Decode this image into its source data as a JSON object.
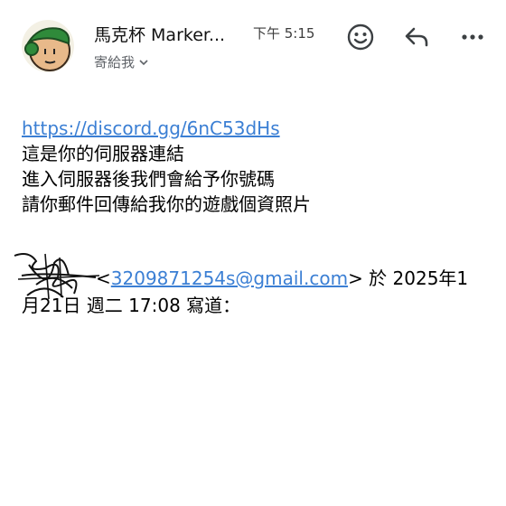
{
  "header": {
    "sender": "馬克杯 Marker...",
    "time": "下午 5:15",
    "to": "寄給我"
  },
  "actions": {
    "emoji_icon": "emoji-icon",
    "reply_icon": "reply-icon",
    "more_icon": "more-icon"
  },
  "message": {
    "link": "https://discord.gg/6nC53dHs",
    "lines": [
      "這是你的伺服器連結",
      "進入伺服器後我們會給予你號碼",
      "請你郵件回傳給我你的遊戲個資照片"
    ]
  },
  "quote": {
    "email_open": "<",
    "email": "3209871254s@gmail.com",
    "after_email": "> 於 2025年1",
    "date_line": "月21日 週二 17:08 寫道："
  },
  "colors": {
    "link": "#3b7fd4",
    "secondary_text": "#5f6368"
  }
}
